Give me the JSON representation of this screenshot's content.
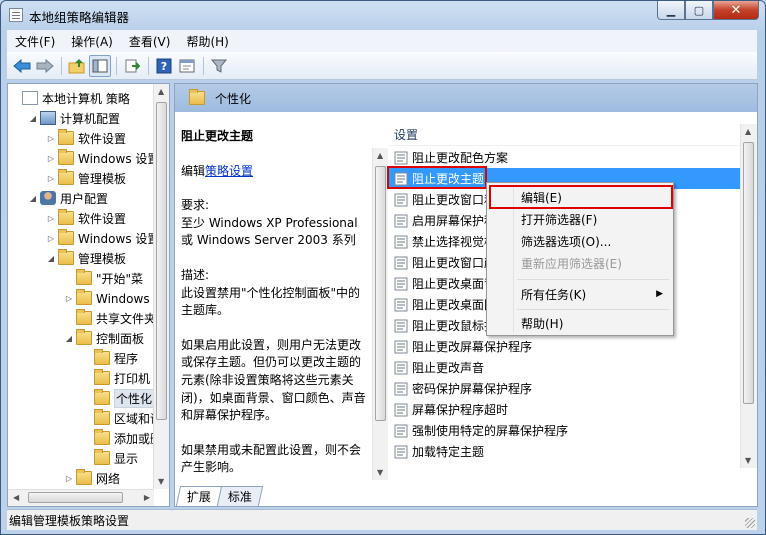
{
  "window": {
    "title": "本地组策略编辑器"
  },
  "menubar": [
    "文件(F)",
    "操作(A)",
    "查看(V)",
    "帮助(H)"
  ],
  "tree": [
    {
      "label": "本地计算机 策略",
      "level": 0,
      "twisty": "",
      "icon": "doc"
    },
    {
      "label": "计算机配置",
      "level": 1,
      "twisty": "◢",
      "icon": "pc"
    },
    {
      "label": "软件设置",
      "level": 2,
      "twisty": "▷",
      "icon": "folder"
    },
    {
      "label": "Windows 设置",
      "level": 2,
      "twisty": "▷",
      "icon": "folder"
    },
    {
      "label": "管理模板",
      "level": 2,
      "twisty": "▷",
      "icon": "folder"
    },
    {
      "label": "用户配置",
      "level": 1,
      "twisty": "◢",
      "icon": "user"
    },
    {
      "label": "软件设置",
      "level": 2,
      "twisty": "▷",
      "icon": "folder"
    },
    {
      "label": "Windows 设置",
      "level": 2,
      "twisty": "▷",
      "icon": "folder"
    },
    {
      "label": "管理模板",
      "level": 2,
      "twisty": "◢",
      "icon": "folder"
    },
    {
      "label": "\"开始\"菜",
      "level": 3,
      "twisty": "",
      "icon": "folder"
    },
    {
      "label": "Windows 组",
      "level": 3,
      "twisty": "▷",
      "icon": "folder"
    },
    {
      "label": "共享文件夹",
      "level": 3,
      "twisty": "",
      "icon": "folder"
    },
    {
      "label": "控制面板",
      "level": 3,
      "twisty": "◢",
      "icon": "folder"
    },
    {
      "label": "程序",
      "level": 4,
      "twisty": "",
      "icon": "folder"
    },
    {
      "label": "打印机",
      "level": 4,
      "twisty": "",
      "icon": "folder"
    },
    {
      "label": "个性化",
      "level": 4,
      "twisty": "",
      "icon": "folder",
      "selected": true
    },
    {
      "label": "区域和语",
      "level": 4,
      "twisty": "",
      "icon": "folder"
    },
    {
      "label": "添加或删",
      "level": 4,
      "twisty": "",
      "icon": "folder"
    },
    {
      "label": "显示",
      "level": 4,
      "twisty": "",
      "icon": "folder"
    },
    {
      "label": "网络",
      "level": 3,
      "twisty": "▷",
      "icon": "folder"
    }
  ],
  "right_header": "个性化",
  "description": {
    "title": "阻止更改主题",
    "edit_prefix": "编辑",
    "edit_link": "策略设置",
    "req_label": "要求:",
    "req_text": "至少 Windows XP Professional 或 Windows Server 2003 系列",
    "desc_label": "描述:",
    "desc_text": "此设置禁用\"个性化控制面板\"中的主题库。",
    "enabled_text": "如果启用此设置，则用户无法更改或保存主题。但仍可以更改主题的元素(除非设置策略将这些元素关闭)，如桌面背景、窗口颜色、声音和屏幕保护程序。",
    "disabled_text": "如果禁用或未配置此设置，则不会产生影响。"
  },
  "list_header": "设置",
  "settings": [
    {
      "label": "阻止更改配色方案"
    },
    {
      "label": "阻止更改主题",
      "selected": true
    },
    {
      "label": "阻止更改窗口和"
    },
    {
      "label": "启用屏幕保护程"
    },
    {
      "label": "禁止选择视觉样"
    },
    {
      "label": "阻止更改窗口颜"
    },
    {
      "label": "阻止更改桌面背"
    },
    {
      "label": "阻止更改桌面图"
    },
    {
      "label": "阻止更改鼠标指"
    },
    {
      "label": "阻止更改屏幕保护程序"
    },
    {
      "label": "阻止更改声音"
    },
    {
      "label": "密码保护屏幕保护程序"
    },
    {
      "label": "屏幕保护程序超时"
    },
    {
      "label": "强制使用特定的屏幕保护程序"
    },
    {
      "label": "加载特定主题"
    }
  ],
  "context_menu": [
    {
      "label": "编辑(E)",
      "highlighted": true
    },
    {
      "label": "打开筛选器(F)"
    },
    {
      "label": "筛选器选项(O)..."
    },
    {
      "label": "重新应用筛选器(E)",
      "disabled": true
    },
    {
      "label": "所有任务(K)",
      "submenu": true
    },
    {
      "label": "帮助(H)"
    }
  ],
  "tabs": [
    "扩展",
    "标准"
  ],
  "status": "编辑管理模板策略设置",
  "colors": {
    "selection": "#3399ff",
    "highlight_box": "#e00000",
    "link": "#0033cc"
  }
}
